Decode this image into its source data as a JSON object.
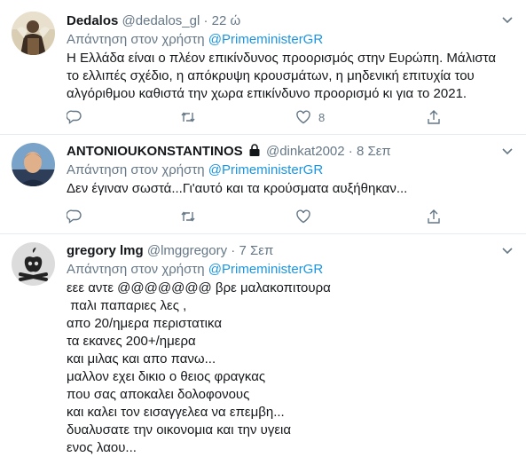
{
  "tweets": [
    {
      "name": "Dedalos",
      "handle": "@dedalos_gl",
      "dot": "·",
      "time": "22 ώ",
      "reply_prefix": "Απάντηση στον χρήστη ",
      "reply_mention": "@PrimeministerGR",
      "lines": [
        "Η Ελλάδα είναι ο πλέον επικίνδυνος προορισμός στην Ευρώπη. Μάλιστα",
        "το ελλιπές σχέδιο, η απόκρυψη κρουσμάτων, η μηδενική επιτυχία του",
        "αλγόριθμου καθιστά την χωρα επικίνδυνο προορισμό κι για το 2021."
      ],
      "like_count": "8"
    },
    {
      "name": "ANTONIOUKONSTANTINOS",
      "handle": "@dinkat2002",
      "dot": "·",
      "time": "8 Σεπ",
      "reply_prefix": "Απάντηση στον χρήστη ",
      "reply_mention": "@PrimeministerGR",
      "lines": [
        "Δεν έγιναν σωστά...Γι'αυτό και τα κρούσματα αυξήθηκαν..."
      ],
      "like_count": ""
    },
    {
      "name": "gregory lmg",
      "handle": "@lmggregory",
      "dot": "·",
      "time": "7 Σεπ",
      "reply_prefix": "Απάντηση στον χρήστη ",
      "reply_mention": "@PrimeministerGR",
      "lines": [
        "εεε αντε @@@@@@@ βρε μαλακοπιτουρα",
        " παλι παπαριες λες ,",
        "απο 20/ημερα περιστατικα",
        "τα εκανες 200+/ημερα",
        "και μιλας και απο πανω...",
        "μαλλον εχει δικιο ο θειος φραγκας",
        "που σας αποκαλει δολοφονους",
        "και καλει τον εισαγγελεα να επεμβη...",
        "δυαλυσατε την οικονομια και την υγεια",
        "ενος λαου..."
      ],
      "like_count": ""
    }
  ],
  "colors": {
    "link": "#1b95e0",
    "secondary": "#657786",
    "primary": "#14171a",
    "divider": "#e6ecf0"
  },
  "icons": [
    "chevron-down-icon",
    "lock-icon",
    "reply-icon",
    "retweet-icon",
    "like-icon",
    "share-icon"
  ]
}
